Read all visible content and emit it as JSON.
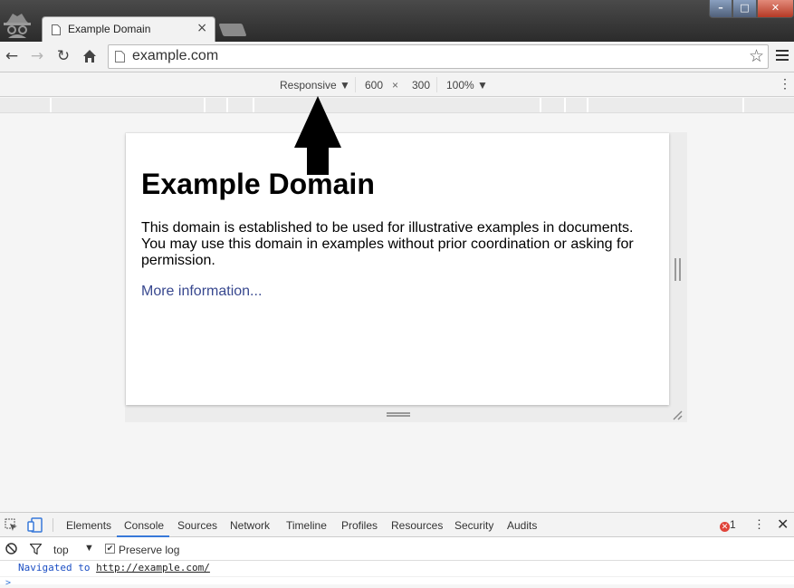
{
  "browser": {
    "tab_title": "Example Domain",
    "tab_close": "×",
    "url": "example.com",
    "window_controls": {
      "minimize": "–",
      "maximize": "□",
      "close": "✕"
    }
  },
  "device_toolbar": {
    "mode": "Responsive ▼",
    "width": "600",
    "times": "×",
    "height": "300",
    "zoom": "100% ▼"
  },
  "page": {
    "heading": "Example Domain",
    "body": "This domain is established to be used for illustrative examples in documents. You may use this domain in examples without prior coordination or asking for permission.",
    "link": "More information..."
  },
  "devtools": {
    "tabs": [
      "Elements",
      "Console",
      "Sources",
      "Network",
      "Timeline",
      "Profiles",
      "Resources",
      "Security",
      "Audits"
    ],
    "active_tab": "Console",
    "error_count": "1",
    "context": "top",
    "preserve_log": "Preserve log",
    "log_prefix": "Navigated to ",
    "log_url": "http://example.com/",
    "prompt": ">"
  },
  "colors": {
    "accent": "#3879d9",
    "error": "#e0443a",
    "link": "#38488f"
  },
  "icons": [
    "incognito-icon",
    "page-icon",
    "back-icon",
    "forward-icon",
    "reload-icon",
    "home-icon",
    "star-icon",
    "menu-icon",
    "inspect-icon",
    "device-icon",
    "clear-icon",
    "filter-icon",
    "kebab-icon",
    "close-icon",
    "up-arrow-annotation"
  ]
}
